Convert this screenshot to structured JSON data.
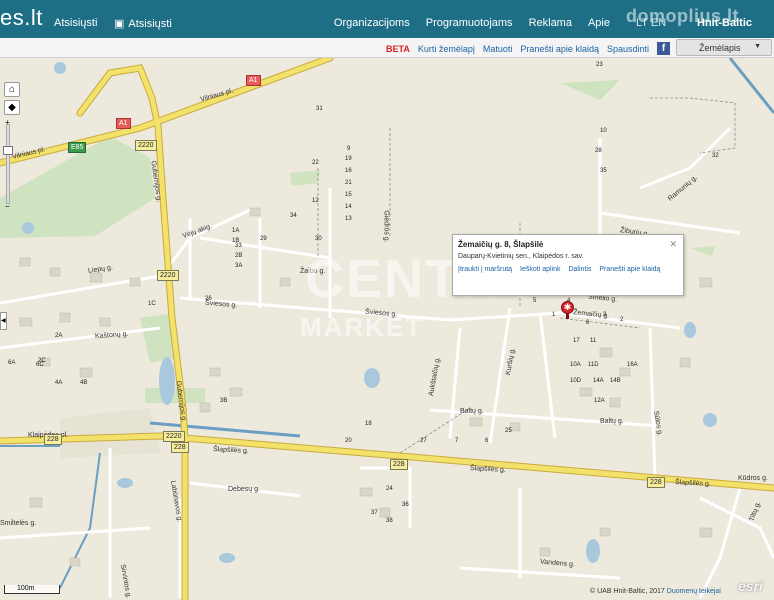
{
  "header": {
    "logo": "es.lt",
    "download_ios": "Atsisiųsti",
    "download_android": "Atsisiųsti",
    "nav": [
      "Organizacijoms",
      "Programuotojams",
      "Reklama",
      "Apie"
    ],
    "lang": "LT  EN",
    "brand": "Hnit-Baltic",
    "watermark": "domoplius.lt"
  },
  "toolbar": {
    "beta": "BETA",
    "items": [
      "Kurti žemėlapį",
      "Matuoti",
      "Pranešti apie klaidą",
      "Spausdinti"
    ],
    "facebook": "f",
    "layer_select": "Žemėlapis"
  },
  "zoom": {
    "plus": "+",
    "minus": "−",
    "zoom_in": "+",
    "zoom_out": "−"
  },
  "popup": {
    "title": "Žemaičių g. 8, Šlapšilė",
    "subtitle": "Dauparų-Kvietinių sen., Klaipėdos r. sav.",
    "links": [
      "Įtraukti į maršrutą",
      "Ieškoti aplink",
      "Dalintis",
      "Pranešti apie klaidą"
    ],
    "close": "✕"
  },
  "map": {
    "watermark_main": "CENTRO",
    "watermark_sub": "MARKET",
    "scale": "100m",
    "attribution": "© UAB Hnit-Baltic, 2017",
    "attribution_link": "Duomenų teikėjai",
    "esri": "esri",
    "streets": {
      "vilniaus_pl": "Vilniaus pl.",
      "vilniaus_pl2": "Vilniaus pl.",
      "klaipedos_pl": "Klaipėdos pl.",
      "slapsiles_g": "Šlapšilės g.",
      "slapsiles_g2": "Šlapšilės g.",
      "slapsiles_g3": "Šlapšilės g.",
      "sviesos_g": "Šviesos g.",
      "sviesos_g2": "Šviesos g.",
      "liepu_g": "Liepų g.",
      "kastonu_g": "Kaštonų g.",
      "vejo_akig": "Vėjų akig.",
      "zaibo_g": "Žaibo g.",
      "gubernijos_g": "Gubernijos g.",
      "gubernijos_g2": "Gubernijos g.",
      "giedros_g": "Giedros g.",
      "ziburiu_g": "Žiburių g.",
      "ramuniu_g": "Ramunių g.",
      "smelio_g": "Smėlio g.",
      "zemaiciu_g": "Žemaičių g.",
      "baltu_g": "Baltų g.",
      "baltu_g2": "Baltų g.",
      "aukstaiciu_g": "Aukštaičių g.",
      "kursiu_g": "Kuršių g.",
      "solos_g": "Sūlos g.",
      "kudros_g": "Kūdros g.",
      "debesu_g": "Debesų g.",
      "smilteles_g": "Smiltelės g.",
      "vandens_g": "Vandens g.",
      "tiltu_g": "Tiltų g.",
      "sirvintos_g": "Sirvintos g.",
      "labunavos_g": "Labūnavos g."
    },
    "shields": {
      "a1a": "A1",
      "a1b": "A1",
      "e85": "E85",
      "r2220a": "2220",
      "r2220b": "2220",
      "r2220c": "2220",
      "r228a": "228",
      "r228b": "228",
      "r228c": "228",
      "r228d": "228"
    },
    "house_numbers": [
      "23",
      "31",
      "10",
      "19",
      "9",
      "22",
      "16",
      "21",
      "15",
      "14",
      "13",
      "12",
      "28",
      "35",
      "34",
      "30",
      "32",
      "29",
      "33",
      "26",
      "18",
      "20",
      "25",
      "27",
      "7",
      "6",
      "5",
      "4",
      "3",
      "2",
      "1",
      "8",
      "11",
      "17",
      "24",
      "36",
      "37",
      "38",
      "1A",
      "1B",
      "1C",
      "2A",
      "2B",
      "2C",
      "3A",
      "3B",
      "4A",
      "4B",
      "6A",
      "6C",
      "10A",
      "12A",
      "14A",
      "14B",
      "10D",
      "11D",
      "16A"
    ]
  },
  "colors": {
    "header": "#1e6f86",
    "map_bg": "#ede9dc",
    "motorway": "#f3e26a",
    "road": "#ffffff",
    "water": "#a8c8de",
    "green": "#cfe3c0",
    "marker": "#d9242c"
  }
}
